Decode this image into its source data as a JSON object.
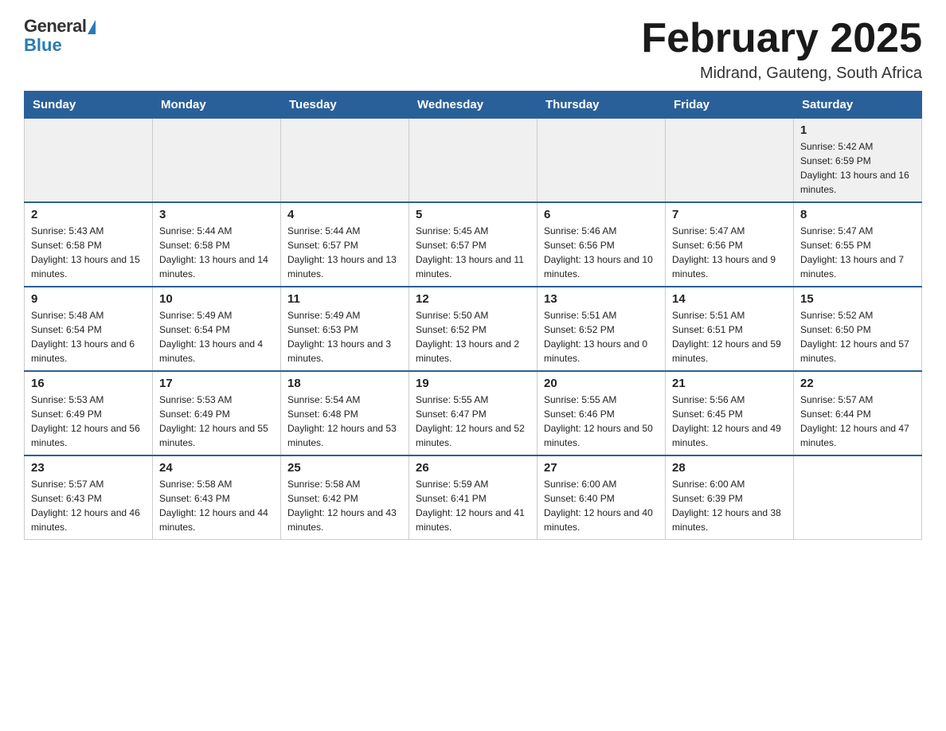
{
  "logo": {
    "general": "General",
    "blue": "Blue"
  },
  "header": {
    "month": "February 2025",
    "location": "Midrand, Gauteng, South Africa"
  },
  "days_of_week": [
    "Sunday",
    "Monday",
    "Tuesday",
    "Wednesday",
    "Thursday",
    "Friday",
    "Saturday"
  ],
  "weeks": [
    [
      {
        "day": "",
        "sunrise": "",
        "sunset": "",
        "daylight": ""
      },
      {
        "day": "",
        "sunrise": "",
        "sunset": "",
        "daylight": ""
      },
      {
        "day": "",
        "sunrise": "",
        "sunset": "",
        "daylight": ""
      },
      {
        "day": "",
        "sunrise": "",
        "sunset": "",
        "daylight": ""
      },
      {
        "day": "",
        "sunrise": "",
        "sunset": "",
        "daylight": ""
      },
      {
        "day": "",
        "sunrise": "",
        "sunset": "",
        "daylight": ""
      },
      {
        "day": "1",
        "sunrise": "Sunrise: 5:42 AM",
        "sunset": "Sunset: 6:59 PM",
        "daylight": "Daylight: 13 hours and 16 minutes."
      }
    ],
    [
      {
        "day": "2",
        "sunrise": "Sunrise: 5:43 AM",
        "sunset": "Sunset: 6:58 PM",
        "daylight": "Daylight: 13 hours and 15 minutes."
      },
      {
        "day": "3",
        "sunrise": "Sunrise: 5:44 AM",
        "sunset": "Sunset: 6:58 PM",
        "daylight": "Daylight: 13 hours and 14 minutes."
      },
      {
        "day": "4",
        "sunrise": "Sunrise: 5:44 AM",
        "sunset": "Sunset: 6:57 PM",
        "daylight": "Daylight: 13 hours and 13 minutes."
      },
      {
        "day": "5",
        "sunrise": "Sunrise: 5:45 AM",
        "sunset": "Sunset: 6:57 PM",
        "daylight": "Daylight: 13 hours and 11 minutes."
      },
      {
        "day": "6",
        "sunrise": "Sunrise: 5:46 AM",
        "sunset": "Sunset: 6:56 PM",
        "daylight": "Daylight: 13 hours and 10 minutes."
      },
      {
        "day": "7",
        "sunrise": "Sunrise: 5:47 AM",
        "sunset": "Sunset: 6:56 PM",
        "daylight": "Daylight: 13 hours and 9 minutes."
      },
      {
        "day": "8",
        "sunrise": "Sunrise: 5:47 AM",
        "sunset": "Sunset: 6:55 PM",
        "daylight": "Daylight: 13 hours and 7 minutes."
      }
    ],
    [
      {
        "day": "9",
        "sunrise": "Sunrise: 5:48 AM",
        "sunset": "Sunset: 6:54 PM",
        "daylight": "Daylight: 13 hours and 6 minutes."
      },
      {
        "day": "10",
        "sunrise": "Sunrise: 5:49 AM",
        "sunset": "Sunset: 6:54 PM",
        "daylight": "Daylight: 13 hours and 4 minutes."
      },
      {
        "day": "11",
        "sunrise": "Sunrise: 5:49 AM",
        "sunset": "Sunset: 6:53 PM",
        "daylight": "Daylight: 13 hours and 3 minutes."
      },
      {
        "day": "12",
        "sunrise": "Sunrise: 5:50 AM",
        "sunset": "Sunset: 6:52 PM",
        "daylight": "Daylight: 13 hours and 2 minutes."
      },
      {
        "day": "13",
        "sunrise": "Sunrise: 5:51 AM",
        "sunset": "Sunset: 6:52 PM",
        "daylight": "Daylight: 13 hours and 0 minutes."
      },
      {
        "day": "14",
        "sunrise": "Sunrise: 5:51 AM",
        "sunset": "Sunset: 6:51 PM",
        "daylight": "Daylight: 12 hours and 59 minutes."
      },
      {
        "day": "15",
        "sunrise": "Sunrise: 5:52 AM",
        "sunset": "Sunset: 6:50 PM",
        "daylight": "Daylight: 12 hours and 57 minutes."
      }
    ],
    [
      {
        "day": "16",
        "sunrise": "Sunrise: 5:53 AM",
        "sunset": "Sunset: 6:49 PM",
        "daylight": "Daylight: 12 hours and 56 minutes."
      },
      {
        "day": "17",
        "sunrise": "Sunrise: 5:53 AM",
        "sunset": "Sunset: 6:49 PM",
        "daylight": "Daylight: 12 hours and 55 minutes."
      },
      {
        "day": "18",
        "sunrise": "Sunrise: 5:54 AM",
        "sunset": "Sunset: 6:48 PM",
        "daylight": "Daylight: 12 hours and 53 minutes."
      },
      {
        "day": "19",
        "sunrise": "Sunrise: 5:55 AM",
        "sunset": "Sunset: 6:47 PM",
        "daylight": "Daylight: 12 hours and 52 minutes."
      },
      {
        "day": "20",
        "sunrise": "Sunrise: 5:55 AM",
        "sunset": "Sunset: 6:46 PM",
        "daylight": "Daylight: 12 hours and 50 minutes."
      },
      {
        "day": "21",
        "sunrise": "Sunrise: 5:56 AM",
        "sunset": "Sunset: 6:45 PM",
        "daylight": "Daylight: 12 hours and 49 minutes."
      },
      {
        "day": "22",
        "sunrise": "Sunrise: 5:57 AM",
        "sunset": "Sunset: 6:44 PM",
        "daylight": "Daylight: 12 hours and 47 minutes."
      }
    ],
    [
      {
        "day": "23",
        "sunrise": "Sunrise: 5:57 AM",
        "sunset": "Sunset: 6:43 PM",
        "daylight": "Daylight: 12 hours and 46 minutes."
      },
      {
        "day": "24",
        "sunrise": "Sunrise: 5:58 AM",
        "sunset": "Sunset: 6:43 PM",
        "daylight": "Daylight: 12 hours and 44 minutes."
      },
      {
        "day": "25",
        "sunrise": "Sunrise: 5:58 AM",
        "sunset": "Sunset: 6:42 PM",
        "daylight": "Daylight: 12 hours and 43 minutes."
      },
      {
        "day": "26",
        "sunrise": "Sunrise: 5:59 AM",
        "sunset": "Sunset: 6:41 PM",
        "daylight": "Daylight: 12 hours and 41 minutes."
      },
      {
        "day": "27",
        "sunrise": "Sunrise: 6:00 AM",
        "sunset": "Sunset: 6:40 PM",
        "daylight": "Daylight: 12 hours and 40 minutes."
      },
      {
        "day": "28",
        "sunrise": "Sunrise: 6:00 AM",
        "sunset": "Sunset: 6:39 PM",
        "daylight": "Daylight: 12 hours and 38 minutes."
      },
      {
        "day": "",
        "sunrise": "",
        "sunset": "",
        "daylight": ""
      }
    ]
  ]
}
